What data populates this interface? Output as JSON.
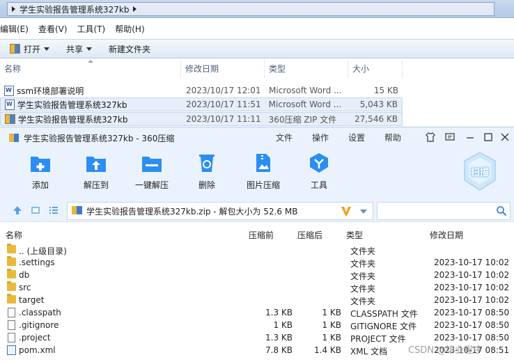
{
  "explorer": {
    "address_path": "学生实验报告管理系统327kb",
    "menu": [
      "编辑(E)",
      "查看(V)",
      "工具(T)",
      "帮助(H)"
    ],
    "toolbar": {
      "open": "打开",
      "share": "共享",
      "new_folder": "新建文件夹"
    },
    "columns": {
      "name": "名称",
      "date": "修改日期",
      "type": "类型",
      "size": "大小"
    },
    "files": [
      {
        "name": "ssm环境部署说明",
        "date": "2023/10/17 12:01",
        "type": "Microsoft Word ...",
        "size": "15 KB",
        "icon": "word-doc-icon"
      },
      {
        "name": "学生实验报告管理系统327kb",
        "date": "2023/10/17 11:51",
        "type": "Microsoft Word ...",
        "size": "5,043 KB",
        "icon": "word-doc-icon"
      },
      {
        "name": "学生实验报告管理系统327kb",
        "date": "2023/10/17 11:11",
        "type": "360压缩 ZIP 文件",
        "size": "27,546 KB",
        "icon": "zip-archive-icon"
      }
    ]
  },
  "zipapp": {
    "title": "学生实验报告管理系统327kb - 360压缩",
    "menu": [
      "文件",
      "操作",
      "设置",
      "帮助"
    ],
    "tools": [
      {
        "label": "添加",
        "icon": "add-to-archive-icon"
      },
      {
        "label": "解压到",
        "icon": "extract-to-icon"
      },
      {
        "label": "一键解压",
        "icon": "one-click-extract-icon"
      },
      {
        "label": "删除",
        "icon": "delete-recycle-icon"
      },
      {
        "label": "图片压缩",
        "icon": "image-compress-icon"
      },
      {
        "label": "工具",
        "icon": "tools-shield-icon"
      }
    ],
    "scan_label": "扫描",
    "path_text": "学生实验报告管理系统327kb.zip - 解包大小为 52.6 MB",
    "columns": {
      "name": "名称",
      "packed": "压缩前",
      "compressed": "压缩后",
      "type": "类型",
      "date": "修改日期"
    },
    "rows": [
      {
        "name": ".. (上级目录)",
        "packed": "",
        "compressed": "",
        "type": "文件夹",
        "date": "",
        "icon": "folder-icon"
      },
      {
        "name": ".settings",
        "packed": "",
        "compressed": "",
        "type": "文件夹",
        "date": "2023-10-17 10:02",
        "icon": "folder-icon"
      },
      {
        "name": "db",
        "packed": "",
        "compressed": "",
        "type": "文件夹",
        "date": "2023-10-17 10:02",
        "icon": "folder-icon"
      },
      {
        "name": "src",
        "packed": "",
        "compressed": "",
        "type": "文件夹",
        "date": "2023-10-17 10:02",
        "icon": "folder-icon"
      },
      {
        "name": "target",
        "packed": "",
        "compressed": "",
        "type": "文件夹",
        "date": "2023-10-17 10:02",
        "icon": "folder-icon"
      },
      {
        "name": ".classpath",
        "packed": "1.3 KB",
        "compressed": "1 KB",
        "type": "CLASSPATH 文件",
        "date": "2023-10-17 08:50",
        "icon": "file-icon"
      },
      {
        "name": ".gitignore",
        "packed": "1 KB",
        "compressed": "1 KB",
        "type": "GITIGNORE 文件",
        "date": "2023-10-17 08:50",
        "icon": "file-icon"
      },
      {
        "name": ".project",
        "packed": "1.3 KB",
        "compressed": "1 KB",
        "type": "PROJECT 文件",
        "date": "2023-10-17 08:50",
        "icon": "file-icon"
      },
      {
        "name": "pom.xml",
        "packed": "7.8 KB",
        "compressed": "1.4 KB",
        "type": "XML 文档",
        "date": "2023-10-17 08:51",
        "icon": "xml-file-icon"
      }
    ]
  },
  "watermark": "CSDN @毕业程序"
}
